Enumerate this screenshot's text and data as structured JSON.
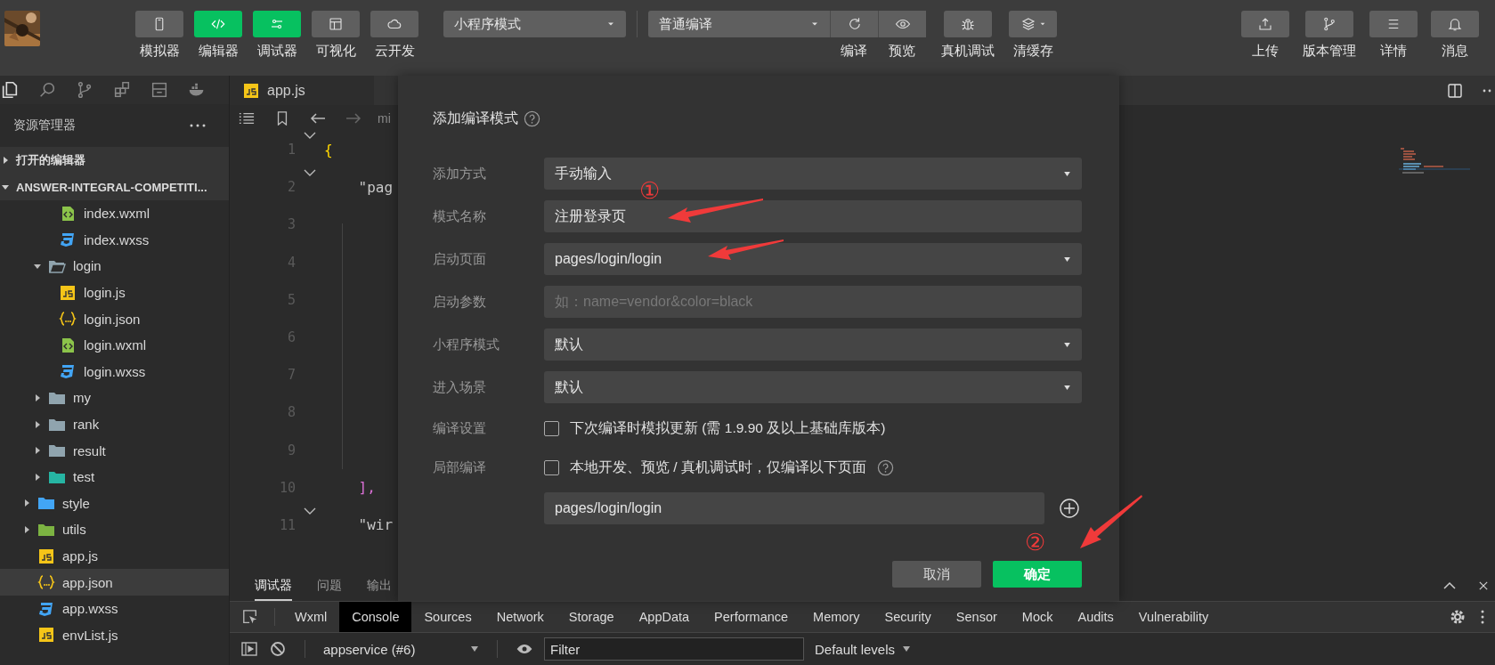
{
  "toolbar": {
    "view_buttons": [
      {
        "label": "模拟器",
        "on": false
      },
      {
        "label": "编辑器",
        "on": true
      },
      {
        "label": "调试器",
        "on": true
      },
      {
        "label": "可视化",
        "on": false
      },
      {
        "label": "云开发",
        "on": false
      }
    ],
    "mode_select": {
      "value": "小程序模式"
    },
    "compile_select": {
      "value": "普通编译"
    },
    "actions": [
      {
        "label": "编译"
      },
      {
        "label": "预览"
      }
    ],
    "tools": [
      {
        "label": "真机调试",
        "dropdown": false
      },
      {
        "label": "清缓存",
        "dropdown": true
      }
    ],
    "right_buttons": [
      {
        "label": "上传"
      },
      {
        "label": "版本管理"
      },
      {
        "label": "详情"
      },
      {
        "label": "消息"
      }
    ]
  },
  "explorer": {
    "title": "资源管理器",
    "sections": [
      {
        "label": "打开的编辑器",
        "expanded": false
      },
      {
        "label": "ANSWER-INTEGRAL-COMPETITI...",
        "expanded": true
      }
    ],
    "tree": [
      {
        "children": [
          {
            "children": [
              {
                "label": "index.wxml",
                "kind": "wxml",
                "selected": false
              },
              {
                "label": "index.wxss",
                "kind": "wxss",
                "selected": false
              }
            ]
          },
          {
            "label": "login",
            "kind": "folder",
            "expanded": true,
            "selected": false,
            "children": [
              {
                "label": "login.js",
                "kind": "js",
                "selected": false
              },
              {
                "label": "login.json",
                "kind": "json",
                "selected": false
              },
              {
                "label": "login.wxml",
                "kind": "wxml",
                "selected": false
              },
              {
                "label": "login.wxss",
                "kind": "wxss",
                "selected": false
              }
            ]
          },
          {
            "label": "my",
            "kind": "folder",
            "expanded": false,
            "selected": false
          },
          {
            "label": "rank",
            "kind": "folder",
            "expanded": false,
            "selected": false
          },
          {
            "label": "result",
            "kind": "folder",
            "expanded": false,
            "selected": false
          },
          {
            "label": "test",
            "kind": "folder-test",
            "expanded": false,
            "selected": false
          }
        ]
      },
      {
        "label": "style",
        "kind": "folder-style",
        "expanded": false,
        "selected": false
      },
      {
        "label": "utils",
        "kind": "folder-utils",
        "expanded": false,
        "selected": false
      },
      {
        "label": "app.js",
        "kind": "js",
        "selected": false
      },
      {
        "label": "app.json",
        "kind": "json",
        "selected": true
      },
      {
        "label": "app.wxss",
        "kind": "wxss",
        "selected": false
      },
      {
        "label": "envList.js",
        "kind": "js",
        "selected": false
      }
    ]
  },
  "editor": {
    "tabs": [
      {
        "label": "app.js",
        "kind": "js"
      }
    ],
    "breadcrumb": "mi",
    "lines": [
      {
        "number": "1",
        "code": "{",
        "kind": "brace",
        "fold": true
      },
      {
        "number": "2",
        "code": "    \"pag",
        "kind": "string",
        "fold": true
      },
      {
        "number": "3"
      },
      {
        "number": "4"
      },
      {
        "number": "5"
      },
      {
        "number": "6"
      },
      {
        "number": "7"
      },
      {
        "number": "8"
      },
      {
        "number": "9"
      },
      {
        "number": "10",
        "code": "    ],",
        "kind": "bracket",
        "fold": false
      },
      {
        "number": "11",
        "code": "    \"wir",
        "kind": "string",
        "fold": true
      }
    ]
  },
  "dialog": {
    "title": "添加编译模式",
    "fields": [
      {
        "label": "添加方式",
        "kind": "select",
        "value": "手动输入"
      },
      {
        "label": "模式名称",
        "kind": "input",
        "value": "注册登录页"
      },
      {
        "label": "启动页面",
        "kind": "select",
        "value": "pages/login/login"
      },
      {
        "label": "启动参数",
        "kind": "input",
        "placeholder": "如：name=vendor&color=black"
      },
      {
        "label": "小程序模式",
        "kind": "select",
        "value": "默认"
      },
      {
        "label": "进入场景",
        "kind": "select",
        "value": "默认"
      },
      {
        "label": "编译设置",
        "kind": "checkbox",
        "checked": false,
        "text": "下次编译时模拟更新 (需 1.9.90 及以上基础库版本)",
        "help": false
      },
      {
        "label": "局部编译",
        "kind": "checkbox",
        "checked": false,
        "text": "本地开发、预览 / 真机调试时，仅编译以下页面",
        "help": true
      }
    ],
    "page_input": {
      "value": "pages/login/login"
    },
    "buttons": [
      {
        "label": "取消",
        "kind": "secondary"
      },
      {
        "label": "确定",
        "kind": "primary"
      }
    ]
  },
  "annotations": [
    {
      "text": "①"
    },
    {
      "text": "②"
    }
  ],
  "panel": {
    "tabs": [
      {
        "label": "调试器",
        "selected": true
      },
      {
        "label": "问题",
        "selected": false
      },
      {
        "label": "输出",
        "selected": false
      }
    ],
    "devtools_tabs": [
      {
        "label": "Wxml",
        "selected": false
      },
      {
        "label": "Console",
        "selected": true
      },
      {
        "label": "Sources",
        "selected": false
      },
      {
        "label": "Network",
        "selected": false
      },
      {
        "label": "Storage",
        "selected": false
      },
      {
        "label": "AppData",
        "selected": false
      },
      {
        "label": "Performance",
        "selected": false
      },
      {
        "label": "Memory",
        "selected": false
      },
      {
        "label": "Security",
        "selected": false
      },
      {
        "label": "Sensor",
        "selected": false
      },
      {
        "label": "Mock",
        "selected": false
      },
      {
        "label": "Audits",
        "selected": false
      },
      {
        "label": "Vulnerability",
        "selected": false
      }
    ],
    "console": {
      "context": "appservice (#6)",
      "filter_placeholder": "Filter",
      "levels": "Default levels"
    }
  }
}
